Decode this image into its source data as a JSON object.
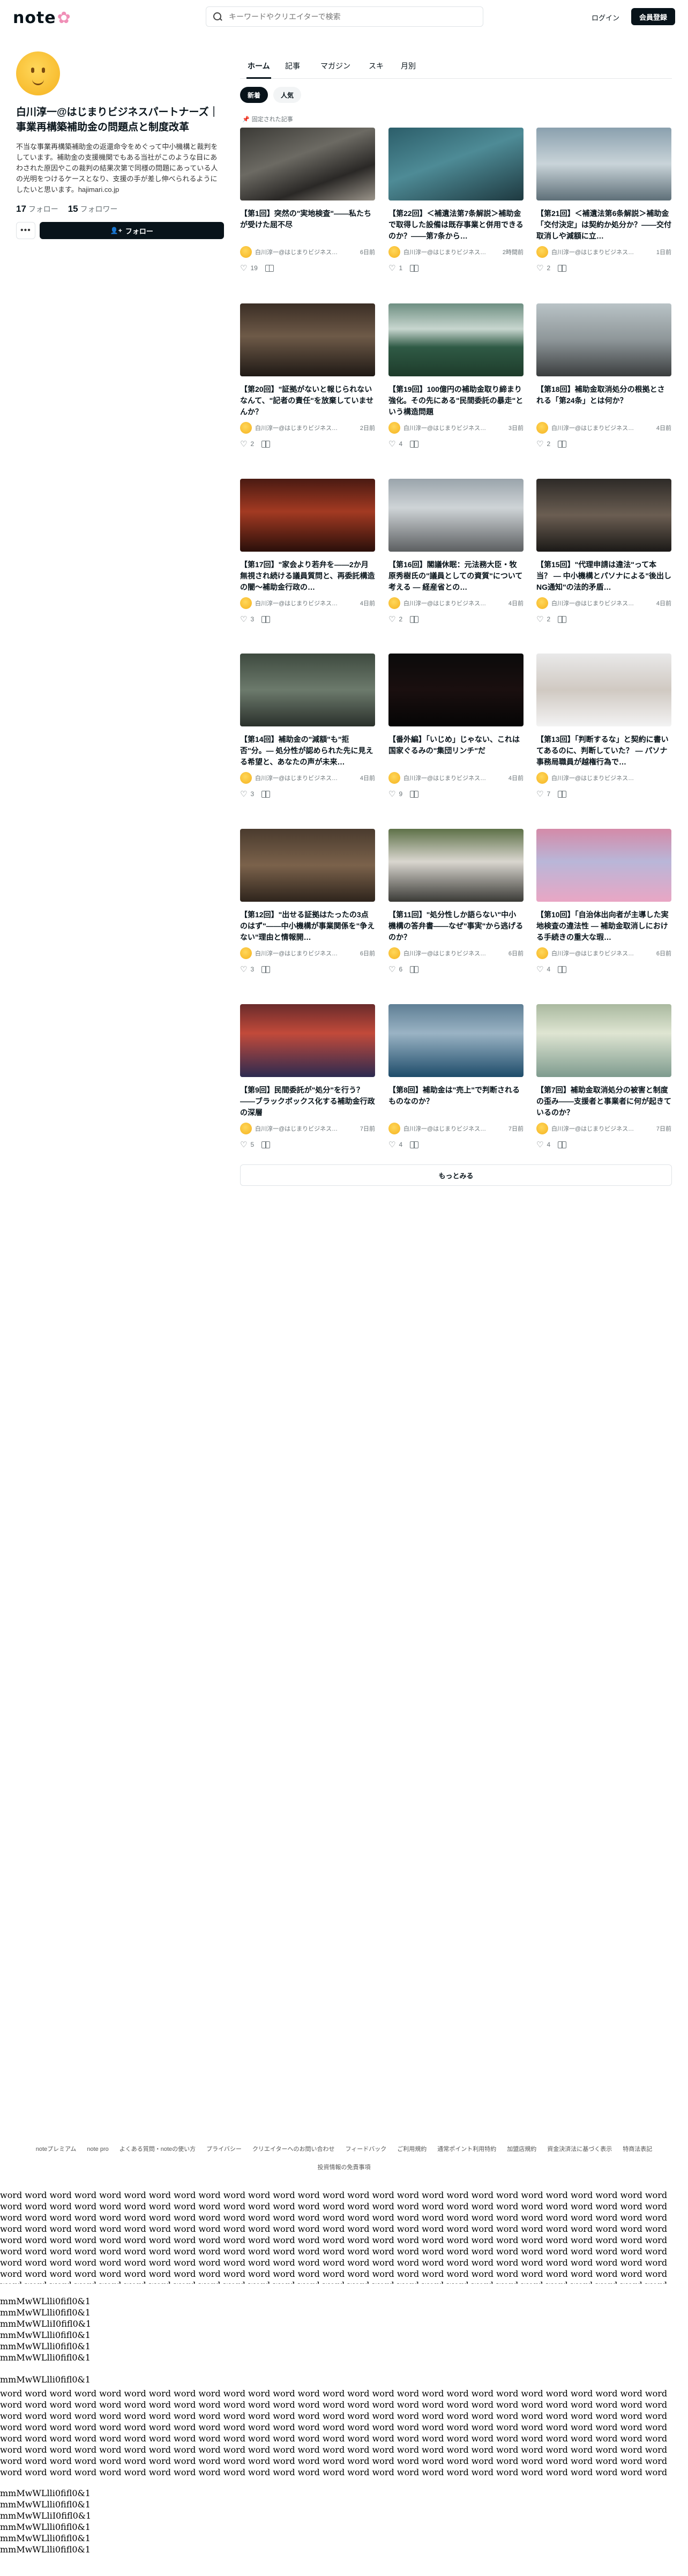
{
  "header": {
    "logo": "note",
    "search_placeholder": "キーワードやクリエイターで検索",
    "login": "ログイン",
    "signup": "会員登録"
  },
  "profile": {
    "name": "白川淳一@はじまりビジネスパートナーズ｜事業再構築補助金の問題点と制度改革",
    "bio": "不当な事業再構築補助金の返還命令をめぐって中小機構と裁判をしています。補助金の支援機関でもある当社がこのような目にあわされた原因やこの裁判の結果次第で同様の問題にあっている人の光明をつけるケースとなり、支援の手が差し伸べられるようにしたいと思います。hajimari.co.jp",
    "following_count": "17",
    "following_label": "フォロー",
    "followers_count": "15",
    "followers_label": "フォロワー",
    "follow_button": "フォロー"
  },
  "tabs": [
    "ホーム",
    "記事",
    "マガジン",
    "スキ",
    "月別"
  ],
  "sort": {
    "new": "新着",
    "popular": "人気"
  },
  "pinned_label": "固定された記事",
  "author": "白川淳一@はじまりビジネスパートナーズ｜事業再構築補助金の問題点と制度改革",
  "articles": [
    {
      "title": "【第1回】突然の\"実地検査\"――私たちが受けた屈不尽",
      "time": "6日前",
      "likes": "19"
    },
    {
      "title": "【第22回】＜補遺法第7条解説＞補助金で取得した設備は既存事業と併用できるのか？――第7条から…",
      "time": "2時間前",
      "likes": "1"
    },
    {
      "title": "【第21回】＜補遺法第6条解説＞補助金「交付決定」は契約か処分か？――交付取消しや減額に立…",
      "time": "1日前",
      "likes": "2"
    },
    {
      "title": "【第20回】\"証拠がないと報じられないなんて、\"記者の責任\"を放棄していませんか？",
      "time": "2日前",
      "likes": "2"
    },
    {
      "title": "【第19回】100億円の補助金取り締まり強化。その先にある\"民間委託の暴走\"という構造問題",
      "time": "3日前",
      "likes": "4"
    },
    {
      "title": "【第18回】補助金取消処分の根拠とされる「第24条」とは何か？",
      "time": "4日前",
      "likes": "2"
    },
    {
      "title": "【第17回】\"家会より若弁を――2か月無視され続ける議員質問と、再委託構造の闇～補助金行政の…",
      "time": "4日前",
      "likes": "3"
    },
    {
      "title": "【第16回】閣議休眠：元法務大臣・牧原秀樹氏の\"議員としての資質\"について考える ― 経産省との…",
      "time": "4日前",
      "likes": "2"
    },
    {
      "title": "【第15回】\"代理申請は違法\"って本当？ ― 中小機構とパソナによる\"後出しNG通知\"の法的矛盾…",
      "time": "4日前",
      "likes": "2"
    },
    {
      "title": "【第14回】補助金の\"減額\"も\"拒否\"分。― 処分性が認められた先に見える希望と、あなたの声が未来…",
      "time": "4日前",
      "likes": "3"
    },
    {
      "title": "【番外編】「いじめ」じゃない、これは国家ぐるみの\"集団リンチ\"だ",
      "time": "4日前",
      "likes": "9"
    },
    {
      "title": "【第13回】「判断するな」と契約に書いてあるのに、判断していた？ ― パソナ事務局職員が越権行為で…",
      "time": "",
      "likes": "7"
    },
    {
      "title": "【第12回】\"出せる証拠はたったの3点のはず\"――中小機構が事業関係を\"争えない\"理由と情報開…",
      "time": "6日前",
      "likes": "3"
    },
    {
      "title": "【第11回】\"処分性しか語らない\"中小機構の答弁書――なぜ\"事実\"から逃げるのか？",
      "time": "6日前",
      "likes": "6"
    },
    {
      "title": "【第10回】「自治体出向者が主導した実地検査の違法性 ― 補助金取消しにおける手続きの重大な瑕…",
      "time": "6日前",
      "likes": "4"
    },
    {
      "title": "【第9回】民間委託が\"処分\"を行う？――ブラックボックス化する補助金行政の深層",
      "time": "7日前",
      "likes": "5"
    },
    {
      "title": "【第8回】補助金は\"売上\"で判断されるものなのか？",
      "time": "7日前",
      "likes": "4"
    },
    {
      "title": "【第7回】補助金取消処分の被害と制度の歪み――支援者と事業者に何が起きているのか？",
      "time": "7日前",
      "likes": "4"
    }
  ],
  "more_button": "もっとみる",
  "footer": {
    "links": [
      "noteプレミアム",
      "note pro",
      "よくある質問・noteの使い方",
      "プライバシー",
      "クリエイターへのお問い合わせ",
      "フィードバック",
      "ご利用規約",
      "通常ポイント利用特約",
      "加盟店規約",
      "資金決済法に基づく表示",
      "特商法表記"
    ],
    "links_row2": [
      "投資情報の免責事項"
    ]
  },
  "debug": {
    "words_block_1": "word word word word word word word word word word word word word word word word word word word word word word word word word word word word word word word word word word word word word word word word word word word word word word word word word word word word word word word word word word word word word word word word word word word word word word word word word word word word word word word word word word word word word word word word word word word word word word word word word word word word word word word word word word word word word word word word word word word word word word word word word word word word word word word word word word word word word word word word word word word word word word word word word word word word word word word word word word word word word word word word word word word word word word word word word word word word word word word word word word word word word word word word word word word word word word word word word word word word word word word word word word word word word word word word word word word word word word word word word word word word word word word word word word word word word word word word word word word word word word word word word word word word word word word word word word word word word word word word word word word word word",
    "glyphs_1": [
      "mmMwWLlli0fifl0&1",
      "mmMwWLlli0fifl0&1",
      "mmMwWLliI0fifl0&1",
      "mmMwWLlli0fifl0&1",
      "mmMwWLlli0fifl0&1",
      "mmMwWLlli0fifl0&1"
    ],
    "glyphs_2": [
      "mmMwWLlli0fifl0&1"
    ],
    "words_block_2": "word word word word word word word word word word word word word word word word word word word word word word word word word word word word word word word word word word word word word word word word word word word word word word word word word word word word word word word word word word word word word word word word word word word word word word word word word word word word word word word word word word word word word word word word word word word word word word word word word word word word word word word word word word word word word word word word word word word word word word word word word word word word word word word word word word word word word word word word word word word word word word word word word word word word word word word word word word word word word word word word word word word word word word word word word word word word word word word word word word word word word word word word word word word word word word word word word word word word word word word word word word word word word word word word word word word word word word word word word word word word word word word word word word word word word word word word word word word word word word word word word word word word word word word word word word word word word word word word word",
    "glyphs_3": [
      "mmMwWLlli0fifl0&1",
      "mmMwWLlli0fifl0&1",
      "mmMwWLliI0fifl0&1",
      "mmMwWLlli0fifl0&1",
      "mmMwWLlli0fifl0&1",
      "mmMwWLlli0fifl0&1"
    ]
  }
}
